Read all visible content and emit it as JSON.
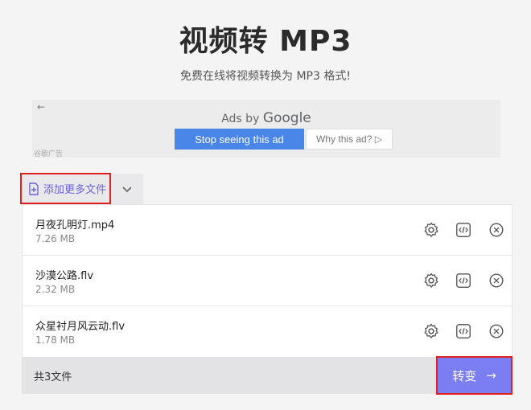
{
  "header": {
    "title": "视频转 MP3",
    "subtitle": "免费在线将视频转换为 MP3 格式!"
  },
  "ad": {
    "back_glyph": "←",
    "ads_by": "Ads by",
    "google": "Google",
    "stop_label": "Stop seeing this ad",
    "why_label": "Why this ad? ▷",
    "marker": "谷歌广告"
  },
  "toolbar": {
    "add_files_label": "添加更多文件"
  },
  "files": [
    {
      "name": "月夜孔明灯.mp4",
      "size": "7.26 MB"
    },
    {
      "name": "沙漠公路.flv",
      "size": "2.32 MB"
    },
    {
      "name": "众星衬月风云动.flv",
      "size": "1.78 MB"
    }
  ],
  "footer": {
    "count_label": "共3文件",
    "convert_label": "转变",
    "convert_arrow": "→"
  },
  "colors": {
    "accent": "#7a7ef0",
    "highlight": "#e02020",
    "ad_button": "#4a86e8"
  },
  "icons": [
    "file-plus-icon",
    "chevron-down-icon",
    "gear-icon",
    "code-icon",
    "close-icon",
    "arrow-right-icon"
  ]
}
